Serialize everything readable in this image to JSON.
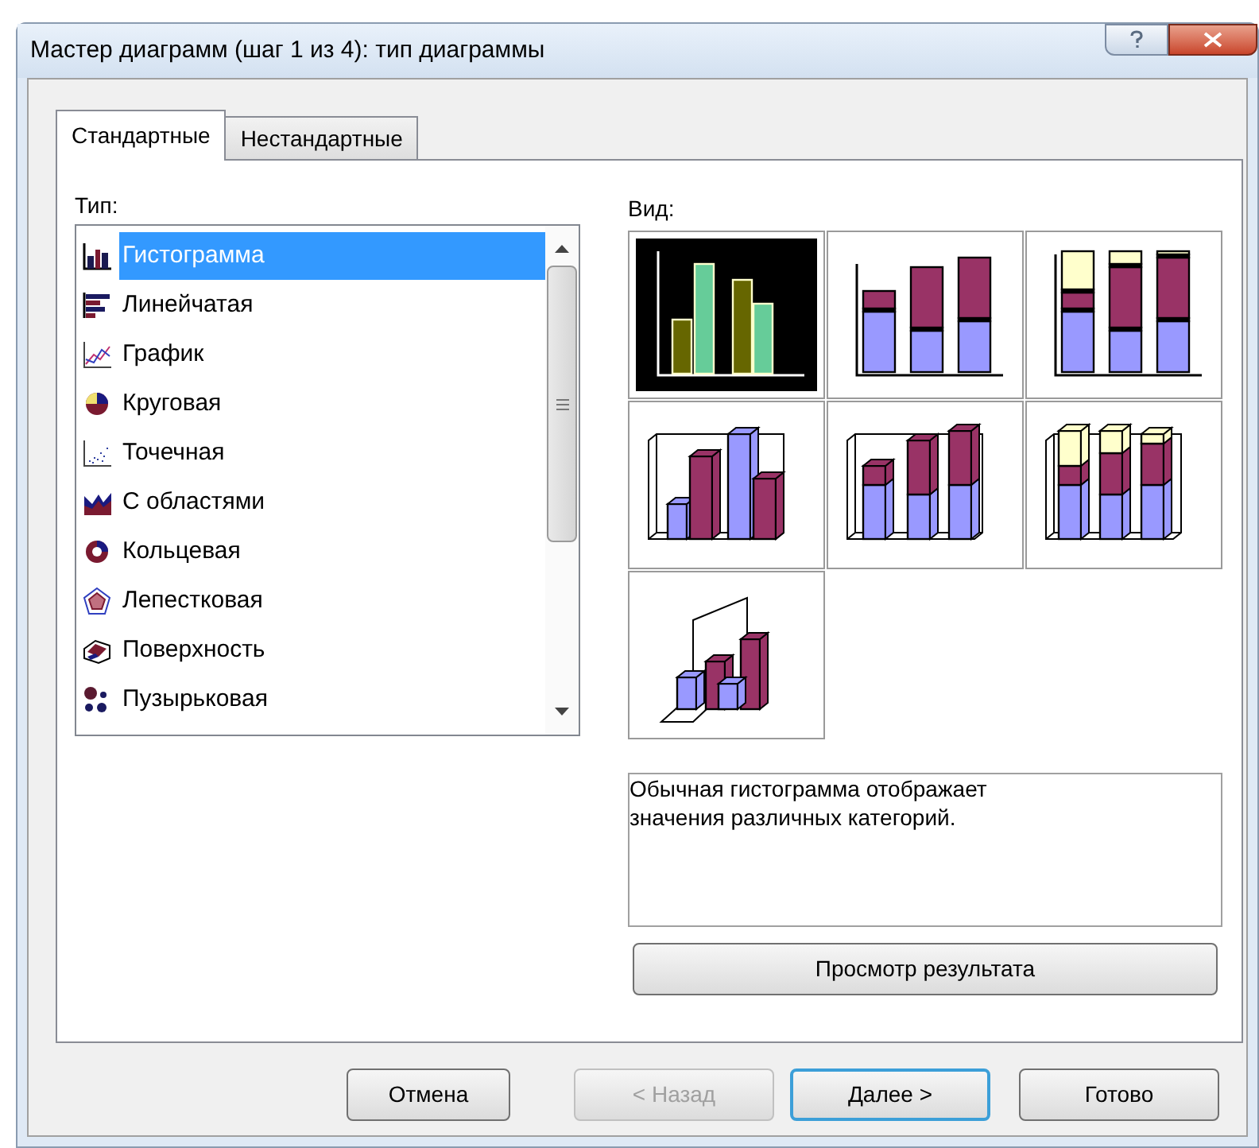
{
  "window": {
    "title": "Мастер диаграмм (шаг 1 из 4): тип диаграммы"
  },
  "tabs": [
    {
      "label": "Стандартные",
      "selected": true
    },
    {
      "label": "Нестандартные",
      "selected": false
    }
  ],
  "type_list": {
    "label": "Тип:",
    "items": [
      {
        "label": "Гистограмма",
        "kind": "column",
        "selected": true
      },
      {
        "label": "Линейчатая",
        "kind": "bar",
        "selected": false
      },
      {
        "label": "График",
        "kind": "line",
        "selected": false
      },
      {
        "label": "Круговая",
        "kind": "pie",
        "selected": false
      },
      {
        "label": "Точечная",
        "kind": "scatter",
        "selected": false
      },
      {
        "label": "С областями",
        "kind": "area",
        "selected": false
      },
      {
        "label": "Кольцевая",
        "kind": "doughnut",
        "selected": false
      },
      {
        "label": "Лепестковая",
        "kind": "radar",
        "selected": false
      },
      {
        "label": "Поверхность",
        "kind": "surface",
        "selected": false
      },
      {
        "label": "Пузырьковая",
        "kind": "bubble",
        "selected": false
      }
    ]
  },
  "subtypes": {
    "label": "Вид:",
    "items": [
      {
        "kind": "clustered",
        "selected": true
      },
      {
        "kind": "stacked",
        "selected": false
      },
      {
        "kind": "percent",
        "selected": false
      },
      {
        "kind": "clustered3d",
        "selected": false
      },
      {
        "kind": "stacked3d",
        "selected": false
      },
      {
        "kind": "percent3d",
        "selected": false
      },
      {
        "kind": "column3d",
        "selected": false
      }
    ],
    "description": "Обычная гистограмма отображает значения различных категорий."
  },
  "preview_button": {
    "label": "Просмотр результата"
  },
  "buttons": [
    {
      "label": "Отмена",
      "disabled": false,
      "default": false
    },
    {
      "label": "< Назад",
      "disabled": true,
      "default": false
    },
    {
      "label": "Далее >",
      "disabled": false,
      "default": true
    },
    {
      "label": "Готово",
      "disabled": false,
      "default": false
    }
  ]
}
